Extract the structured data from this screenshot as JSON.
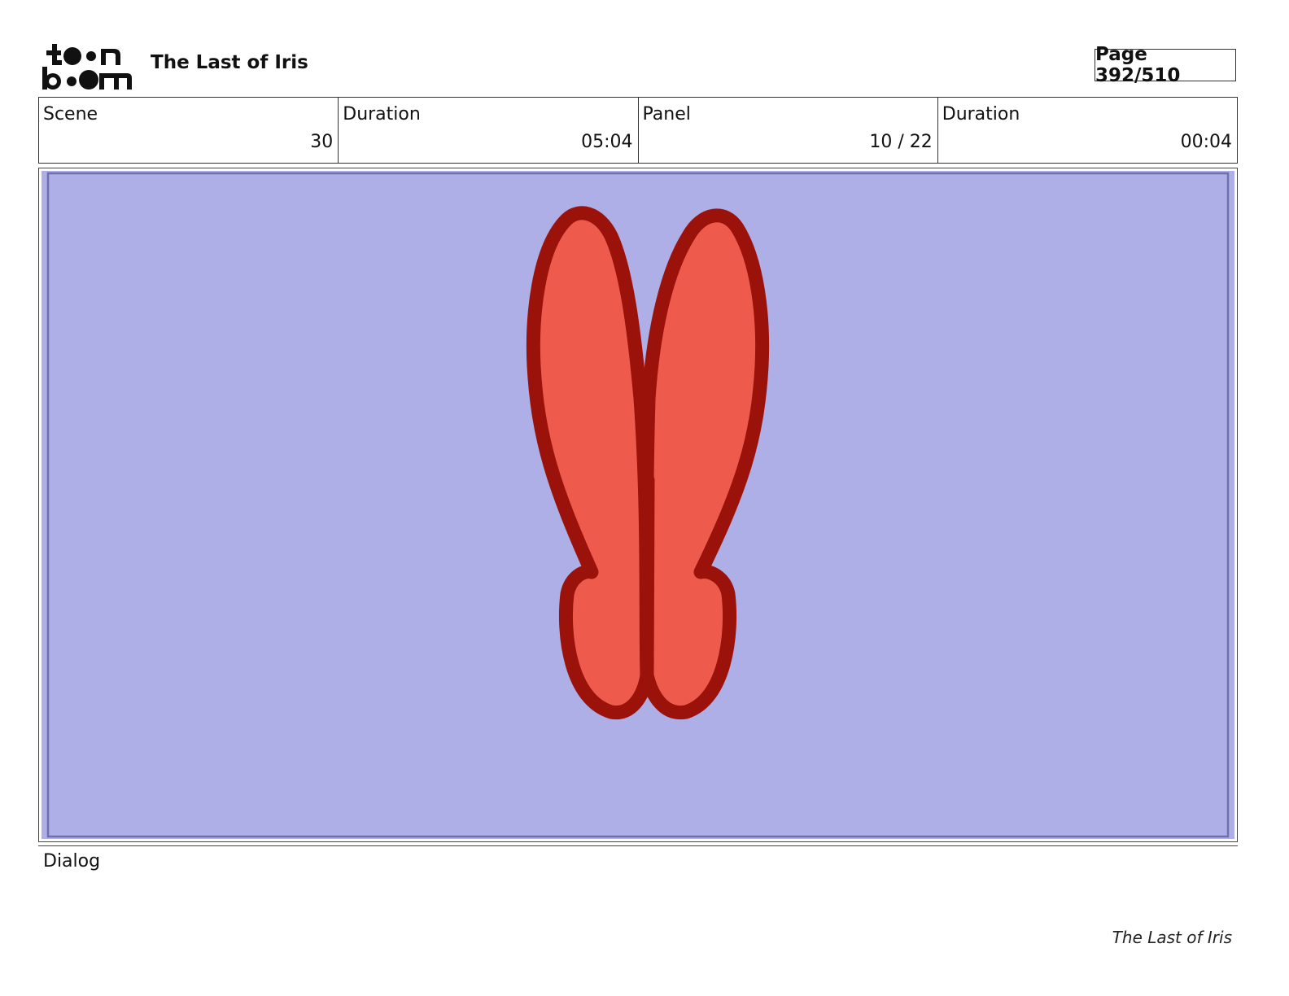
{
  "header": {
    "logo_text": [
      "toon",
      "boom"
    ],
    "title": "The Last of Iris",
    "page": "Page 392/510"
  },
  "info": {
    "scene_label": "Scene",
    "scene_value": "30",
    "scene_duration_label": "Duration",
    "scene_duration_value": "05:04",
    "panel_label": "Panel",
    "panel_value": "10 / 22",
    "panel_duration_label": "Duration",
    "panel_duration_value": "00:04"
  },
  "panel": {
    "background_color": "#afafe7",
    "fill_color": "#ee5a4c",
    "outline_color": "#9a120a"
  },
  "dialog": {
    "label": "Dialog"
  },
  "footer": {
    "title": "The Last of Iris"
  }
}
